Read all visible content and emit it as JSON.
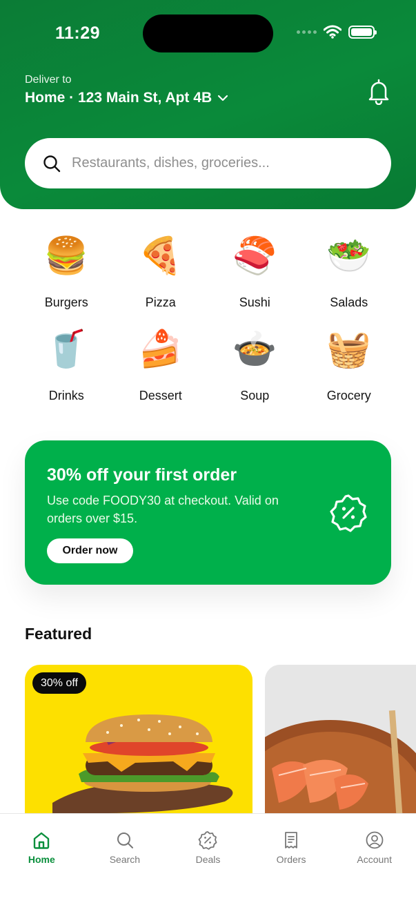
{
  "status_bar": {
    "time": "11:29"
  },
  "header": {
    "deliver_label": "Deliver to",
    "address": "Home · 123 Main St, Apt 4B"
  },
  "search": {
    "placeholder": "Restaurants, dishes, groceries..."
  },
  "categories": [
    {
      "label": "Burgers",
      "icon": "burger-icon",
      "emoji": "🍔"
    },
    {
      "label": "Pizza",
      "icon": "pizza-icon",
      "emoji": "🍕"
    },
    {
      "label": "Sushi",
      "icon": "sushi-icon",
      "emoji": "🍣"
    },
    {
      "label": "Salads",
      "icon": "salad-icon",
      "emoji": "🥗"
    },
    {
      "label": "Drinks",
      "icon": "drinks-icon",
      "emoji": "🥤"
    },
    {
      "label": "Dessert",
      "icon": "dessert-icon",
      "emoji": "🍰"
    },
    {
      "label": "Soup",
      "icon": "soup-icon",
      "emoji": "🍲"
    },
    {
      "label": "Grocery",
      "icon": "grocery-basket-icon",
      "emoji": "🧺"
    }
  ],
  "promo": {
    "title": "30% off your first order",
    "description": "Use code FOODY30 at checkout. Valid on orders over $15.",
    "button_label": "Order now"
  },
  "featured": {
    "title": "Featured",
    "cards": [
      {
        "badge": "30% off",
        "image": "burger-photo"
      },
      {
        "image": "salmon-sushi-photo"
      }
    ]
  },
  "tabbar": {
    "items": [
      {
        "label": "Home",
        "icon": "home-icon",
        "active": true
      },
      {
        "label": "Search",
        "icon": "search-icon",
        "active": false
      },
      {
        "label": "Deals",
        "icon": "discount-icon",
        "active": false
      },
      {
        "label": "Orders",
        "icon": "receipt-icon",
        "active": false
      },
      {
        "label": "Account",
        "icon": "account-icon",
        "active": false
      }
    ]
  },
  "colors": {
    "brand_green": "#0a8a3a",
    "promo_green": "#00b04b",
    "active_tab": "#0a8f3c"
  }
}
